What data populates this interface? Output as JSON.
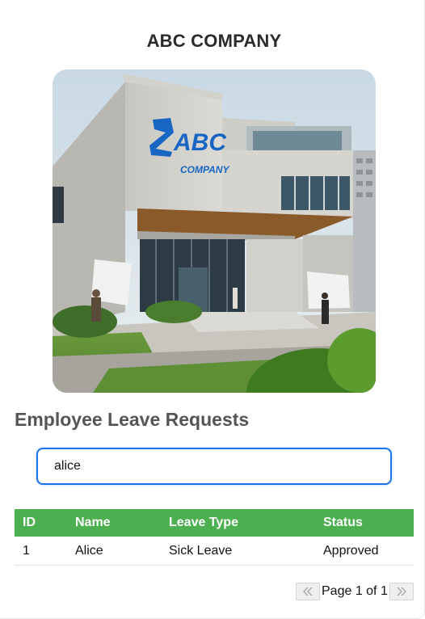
{
  "header": {
    "company_name": "ABC COMPANY"
  },
  "photo": {
    "sign_line1": "ABC",
    "sign_line2": "COMPANY"
  },
  "section": {
    "title": "Employee Leave Requests"
  },
  "search": {
    "value": "alice",
    "placeholder": ""
  },
  "table": {
    "columns": [
      "ID",
      "Name",
      "Leave Type",
      "Status"
    ],
    "rows": [
      {
        "id": "1",
        "name": "Alice",
        "leave_type": "Sick Leave",
        "status": "Approved"
      }
    ]
  },
  "pagination": {
    "text": "Page 1 of 1",
    "prev_icon": "double-chevron-left-icon",
    "next_icon": "double-chevron-right-icon"
  },
  "colors": {
    "accent_blue": "#1a73e8",
    "header_green": "#4caf50"
  }
}
